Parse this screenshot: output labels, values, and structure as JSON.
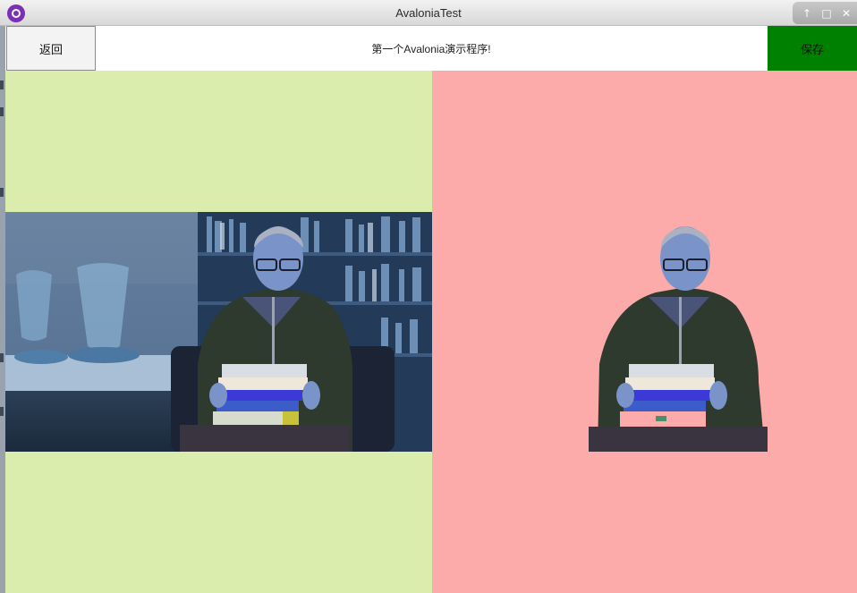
{
  "window": {
    "title": "AvaloniaTest",
    "controls": [
      "maximize-icon",
      "restore-icon",
      "close-icon"
    ]
  },
  "toolbar": {
    "back_label": "返回",
    "page_title": "第一个Avalonia演示程序!",
    "save_label": "保存"
  },
  "colors": {
    "left_panel_bg": "#dbedad",
    "right_panel_bg": "#fdaaaa",
    "save_button_bg": "#008000",
    "app_icon": "#7b2fb5"
  },
  "images": {
    "original": "man-seated-with-books-photo",
    "cutout": "man-seated-with-books-background-removed"
  }
}
